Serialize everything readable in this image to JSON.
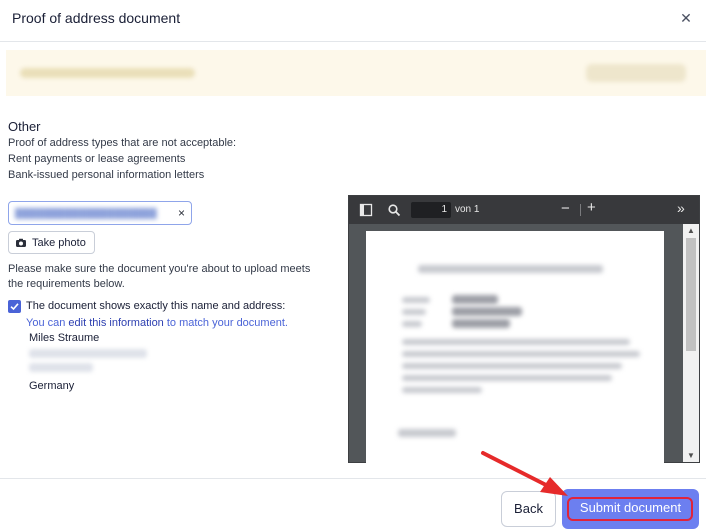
{
  "modal": {
    "title": "Proof of address document",
    "close_icon": "close-icon"
  },
  "notice": {
    "blurred": true
  },
  "section": {
    "title": "Other",
    "desc_line_1": "Proof of address types that are not acceptable:",
    "desc_line_2": "Rent payments or lease agreements",
    "desc_line_3": "Bank-issued personal information letters"
  },
  "upload": {
    "file_chip_remove": "×",
    "take_photo_label": "Take photo",
    "camera_icon": "camera-icon"
  },
  "requirements": {
    "line_1": "Please make sure the document you're about to upload meets",
    "line_2": "the requirements below."
  },
  "confirmation": {
    "checked": true,
    "label": "The document shows exactly this name and address:",
    "hint_prefix": "You can ",
    "hint_link": "edit this information",
    "hint_suffix": " to match your document.",
    "name": "Miles Straume",
    "country": "Germany"
  },
  "pdf_viewer": {
    "page_current": "1",
    "page_of": "von 1",
    "zoom_out": "−",
    "zoom_in": "+",
    "more": "»",
    "icons": [
      "sidebar-icon",
      "search-icon",
      "zoom-out-icon",
      "zoom-in-icon",
      "more-icon"
    ]
  },
  "footer": {
    "back_label": "Back",
    "submit_label": "Submit document"
  },
  "colors": {
    "accent": "#6c7ff0",
    "link": "#2d3fb0",
    "highlight_annotation": "#e0243b",
    "notice_bg": "#fdf8ea"
  }
}
